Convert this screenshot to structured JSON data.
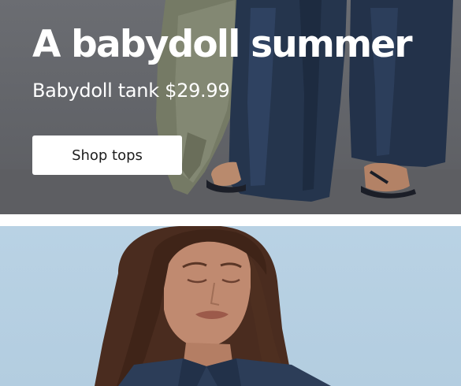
{
  "hero": {
    "title": "A babydoll summer",
    "subtitle": "Babydoll tank $29.99",
    "cta_label": "Shop tops",
    "image": "model-legs-jeans-sandals-photo"
  },
  "promo": {
    "image": "model-portrait-photo"
  },
  "colors": {
    "hero_background": "#656669",
    "promo_background": "#b6cfe2",
    "text_on_image": "#ffffff",
    "button_background": "#ffffff",
    "button_text": "#1c1c1c"
  }
}
